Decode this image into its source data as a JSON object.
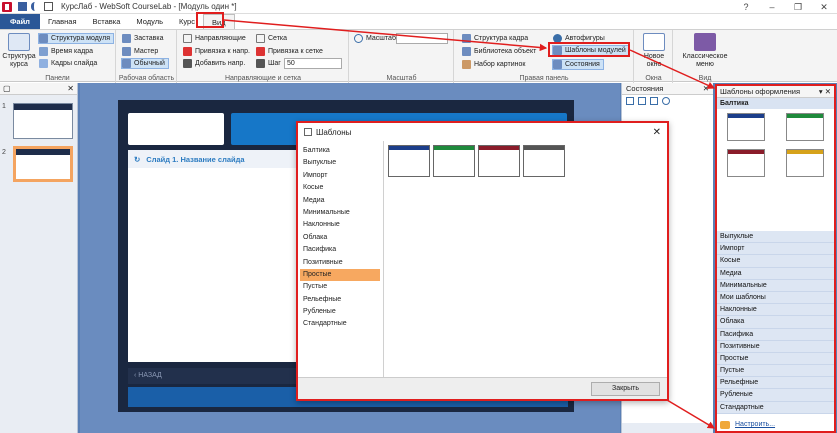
{
  "titlebar": {
    "title": "КурсЛаб - WebSoft CourseLab - [Модуль один *]"
  },
  "ribbon_tabs": [
    "Файл",
    "Главная",
    "Вставка",
    "Модуль",
    "Курс",
    "Вид"
  ],
  "ribbon": {
    "panels": {
      "big_label": "Структура курса",
      "items": [
        "Структура модуля",
        "Время кадра",
        "Кадры слайда"
      ],
      "group": "Панели"
    },
    "workarea": {
      "items": [
        "Заставка",
        "Мастер",
        "Обычный"
      ],
      "group": "Рабочая область"
    },
    "guides": {
      "items": [
        "Направляющие",
        "Привязка к напр.",
        "Добавить напр.",
        "Сетка",
        "Привязка к сетке",
        "Шаг"
      ],
      "step_value": "50",
      "group": "Направляющие и сетка"
    },
    "zoom": {
      "label": "Масштаб",
      "group": "Масштаб"
    },
    "rightpanel": {
      "items": [
        "Структура кадра",
        "Библиотека объект",
        "Набор картинок",
        "Автофигуры",
        "Шаблоны модулей",
        "Состояния"
      ],
      "group": "Правая панель"
    },
    "window": {
      "big_label": "Новое окно",
      "group": "Окна"
    },
    "view": {
      "big_label": "Классическое меню",
      "group": "Вид"
    }
  },
  "slides": {
    "numbers": [
      "1",
      "2"
    ]
  },
  "slide": {
    "title": "Слайд 1. Название слайда",
    "back_label": "НАЗАД"
  },
  "states_panel": {
    "title": "Состояния"
  },
  "templates_panel": {
    "title": "Шаблоны оформления",
    "active_category": "Балтика",
    "categories": [
      "Выпуклые",
      "Импорт",
      "Косые",
      "Медиа",
      "Минимальные",
      "Мои шаблоны",
      "Наклонные",
      "Облака",
      "Пасифика",
      "Позитивные",
      "Простые",
      "Пустые",
      "Рельефные",
      "Рубленые",
      "Стандартные"
    ],
    "setup_link": "Настроить..."
  },
  "dialog": {
    "title": "Шаблоны",
    "list": [
      "Балтика",
      "Выпуклые",
      "Импорт",
      "Косые",
      "Медиа",
      "Минимальные",
      "Наклонные",
      "Облака",
      "Пасифика",
      "Позитивные",
      "Простые",
      "Пустые",
      "Рельефные",
      "Рубленые",
      "Стандартные"
    ],
    "selected": "Простые",
    "ok_label": "Закрыть"
  },
  "colors": {
    "accent": "#2b5797",
    "highlight": "#e01e1e",
    "selection": "#f7a860"
  }
}
